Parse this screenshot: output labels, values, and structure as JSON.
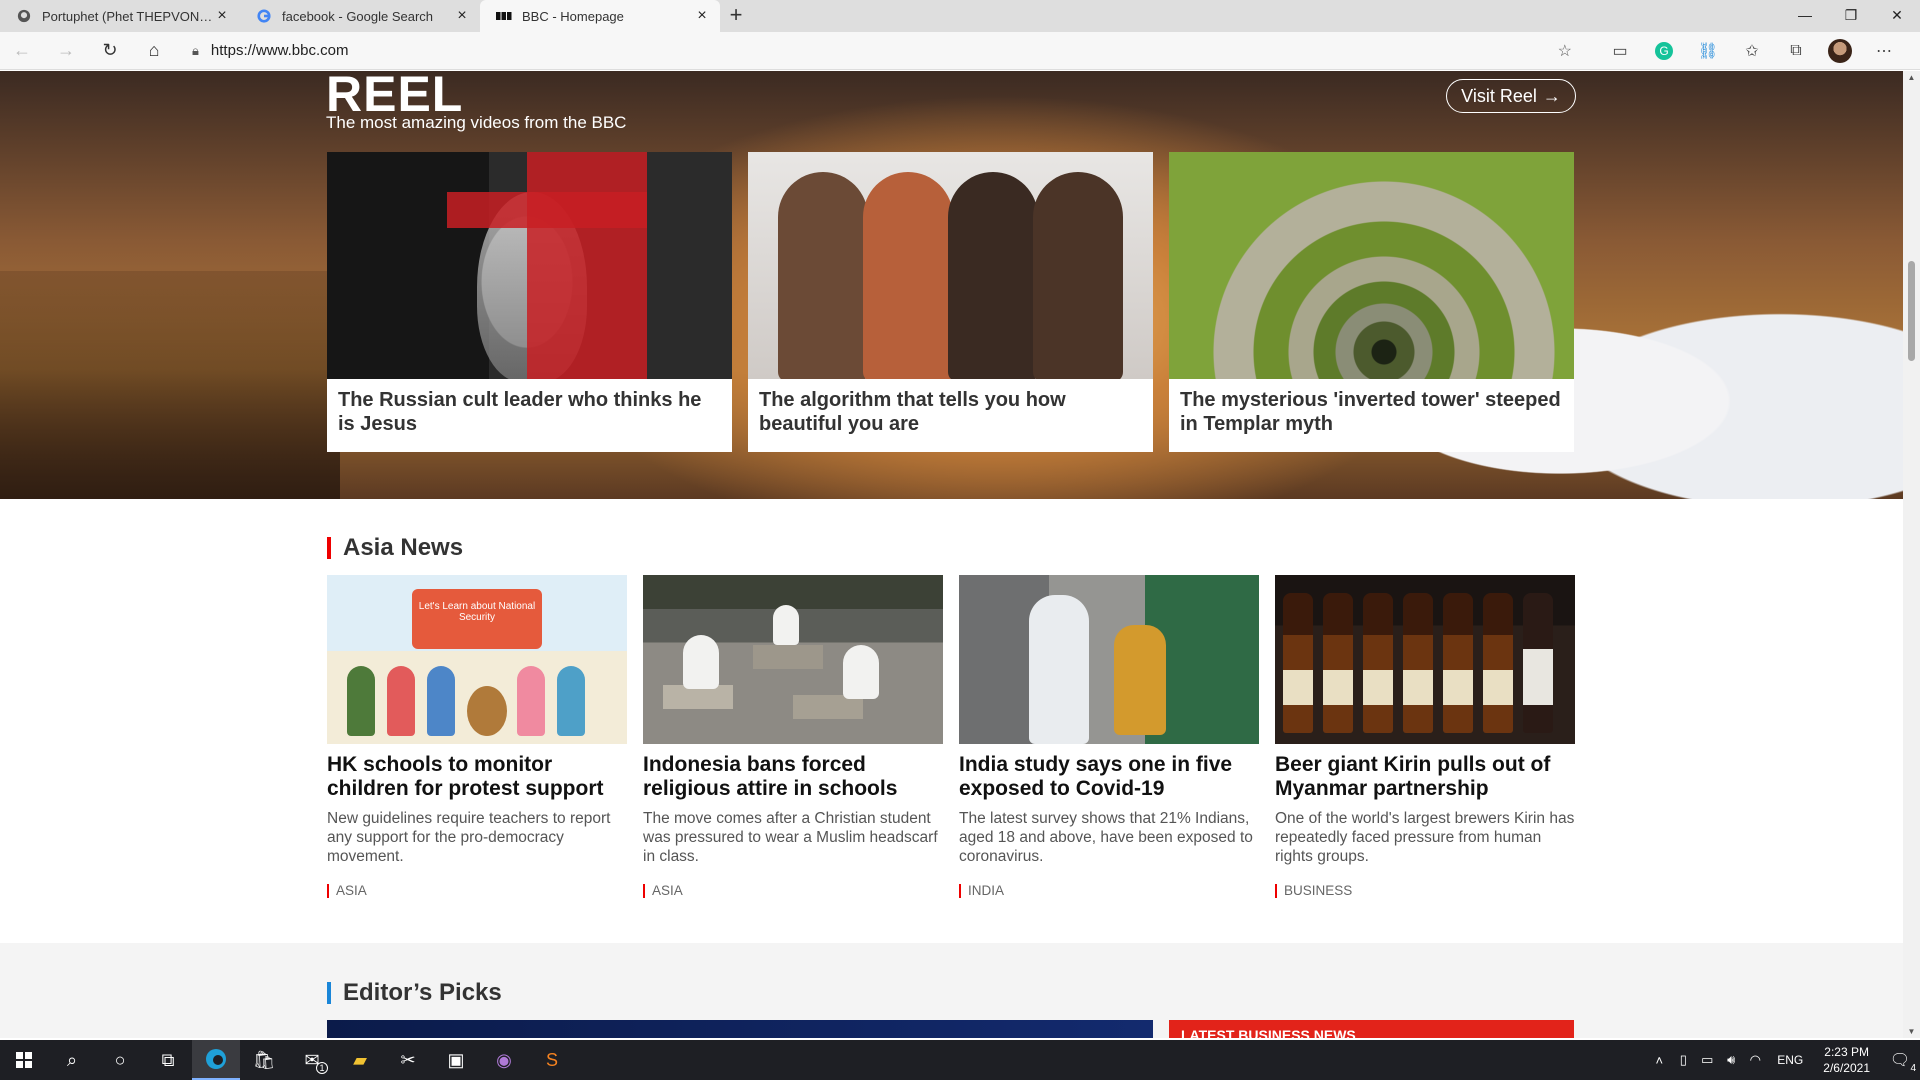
{
  "browser": {
    "tabs": [
      {
        "title": "Portuphet (Phet THEPVONGSA)",
        "icon": "github-icon",
        "active": false
      },
      {
        "title": "facebook - Google Search",
        "icon": "google-icon",
        "active": false
      },
      {
        "title": "BBC - Homepage",
        "icon": "bbc-icon",
        "active": true
      }
    ],
    "url": "https://www.bbc.com"
  },
  "reel": {
    "logo": "REEL",
    "subtitle": "The most amazing videos from the BBC",
    "visit_label": "Visit Reel",
    "cards": [
      {
        "caption": "The Russian cult leader who thinks he is Jesus"
      },
      {
        "caption": "The algorithm that tells you how beautiful you are"
      },
      {
        "caption": "The mysterious 'inverted tower' steeped in Templar myth"
      }
    ]
  },
  "asia": {
    "title": "Asia News",
    "cards": [
      {
        "headline": "HK schools to monitor children for protest support",
        "summary": "New guidelines require teachers to report any support for the pro-democracy movement.",
        "tag": "ASIA",
        "image_text": "Let's Learn about National Security"
      },
      {
        "headline": "Indonesia bans forced religious attire in schools",
        "summary": "The move comes after a Christian student was pressured to wear a Muslim headscarf in class.",
        "tag": "ASIA"
      },
      {
        "headline": "India study says one in five exposed to Covid-19",
        "summary": "The latest survey shows that 21% Indians, aged 18 and above, have been exposed to coronavirus.",
        "tag": "INDIA"
      },
      {
        "headline": "Beer giant Kirin pulls out of Myanmar partnership",
        "summary": "One of the world's largest brewers Kirin has repeatedly faced pressure from human rights groups.",
        "tag": "BUSINESS"
      }
    ]
  },
  "editors": {
    "title": "Editor’s Picks",
    "latest_business": "LATEST BUSINESS NEWS"
  },
  "taskbar": {
    "lang": "ENG",
    "time": "2:23 PM",
    "date": "2/6/2021",
    "mail_badge": "1",
    "notif_badge": "4"
  },
  "colors": {
    "accent_red": "#e00000",
    "editors_blue": "#1a86d8",
    "latest_business_bg": "#e2231a"
  }
}
